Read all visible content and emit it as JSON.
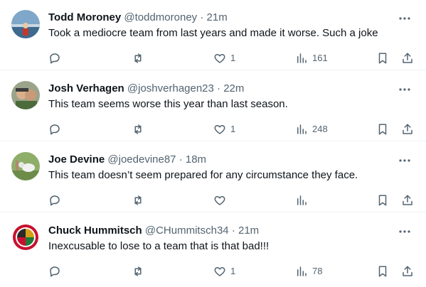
{
  "tweets": [
    {
      "name": "Todd Moroney",
      "handle": "@toddmoroney",
      "separator": "·",
      "time": "21m",
      "text": "Took a mediocre team from last years and made it worse.  Such a joke",
      "likes": "1",
      "views": "161",
      "retweets": "",
      "replies": ""
    },
    {
      "name": "Josh Verhagen",
      "handle": "@joshverhagen23",
      "separator": "·",
      "time": "22m",
      "text": "This team seems worse this year than last season.",
      "likes": "1",
      "views": "248",
      "retweets": "",
      "replies": ""
    },
    {
      "name": "Joe Devine",
      "handle": "@joedevine87",
      "separator": "·",
      "time": "18m",
      "text": "This team doesn’t seem prepared for any circumstance they face.",
      "likes": "",
      "views": "",
      "retweets": "",
      "replies": ""
    },
    {
      "name": "Chuck Hummitsch",
      "handle": "@CHummitsch34",
      "separator": "·",
      "time": "21m",
      "text": "Inexcusable to lose to a team that is that bad!!!",
      "likes": "1",
      "views": "78",
      "retweets": "",
      "replies": ""
    }
  ],
  "icons": {
    "reply": "reply-icon",
    "retweet": "retweet-icon",
    "like": "heart-icon",
    "views": "analytics-icon",
    "bookmark": "bookmark-icon",
    "share": "share-icon",
    "more": "more-icon"
  },
  "colors": {
    "text": "#0f1419",
    "secondary": "#536471",
    "divider": "#eff3f4"
  }
}
